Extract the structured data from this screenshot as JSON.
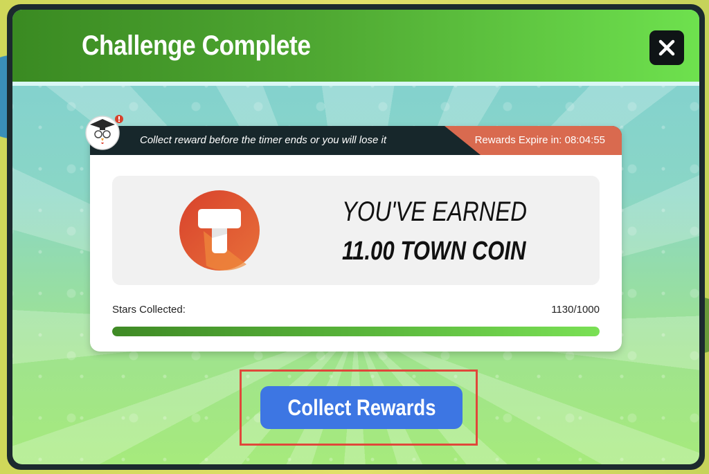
{
  "modal": {
    "title": "Challenge Complete",
    "close_icon": "close-icon"
  },
  "notice": {
    "message": "Collect reward before the timer ends or you will lose it",
    "expire_label": "Rewards Expire in: 08:04:55",
    "mascot_icon": "chicken-mascot-icon"
  },
  "reward": {
    "line1": "YOU'VE EARNED",
    "line2": "11.00 TOWN COIN",
    "coin_icon": "town-coin-icon"
  },
  "progress": {
    "label": "Stars Collected:",
    "count_text": "1130/1000",
    "fraction": 1.0
  },
  "actions": {
    "collect_label": "Collect Rewards"
  },
  "colors": {
    "header_green": "#4fa832",
    "button_blue": "#3d76e3",
    "expire_orange": "#d96a4f",
    "highlight_red": "#e0473a"
  }
}
